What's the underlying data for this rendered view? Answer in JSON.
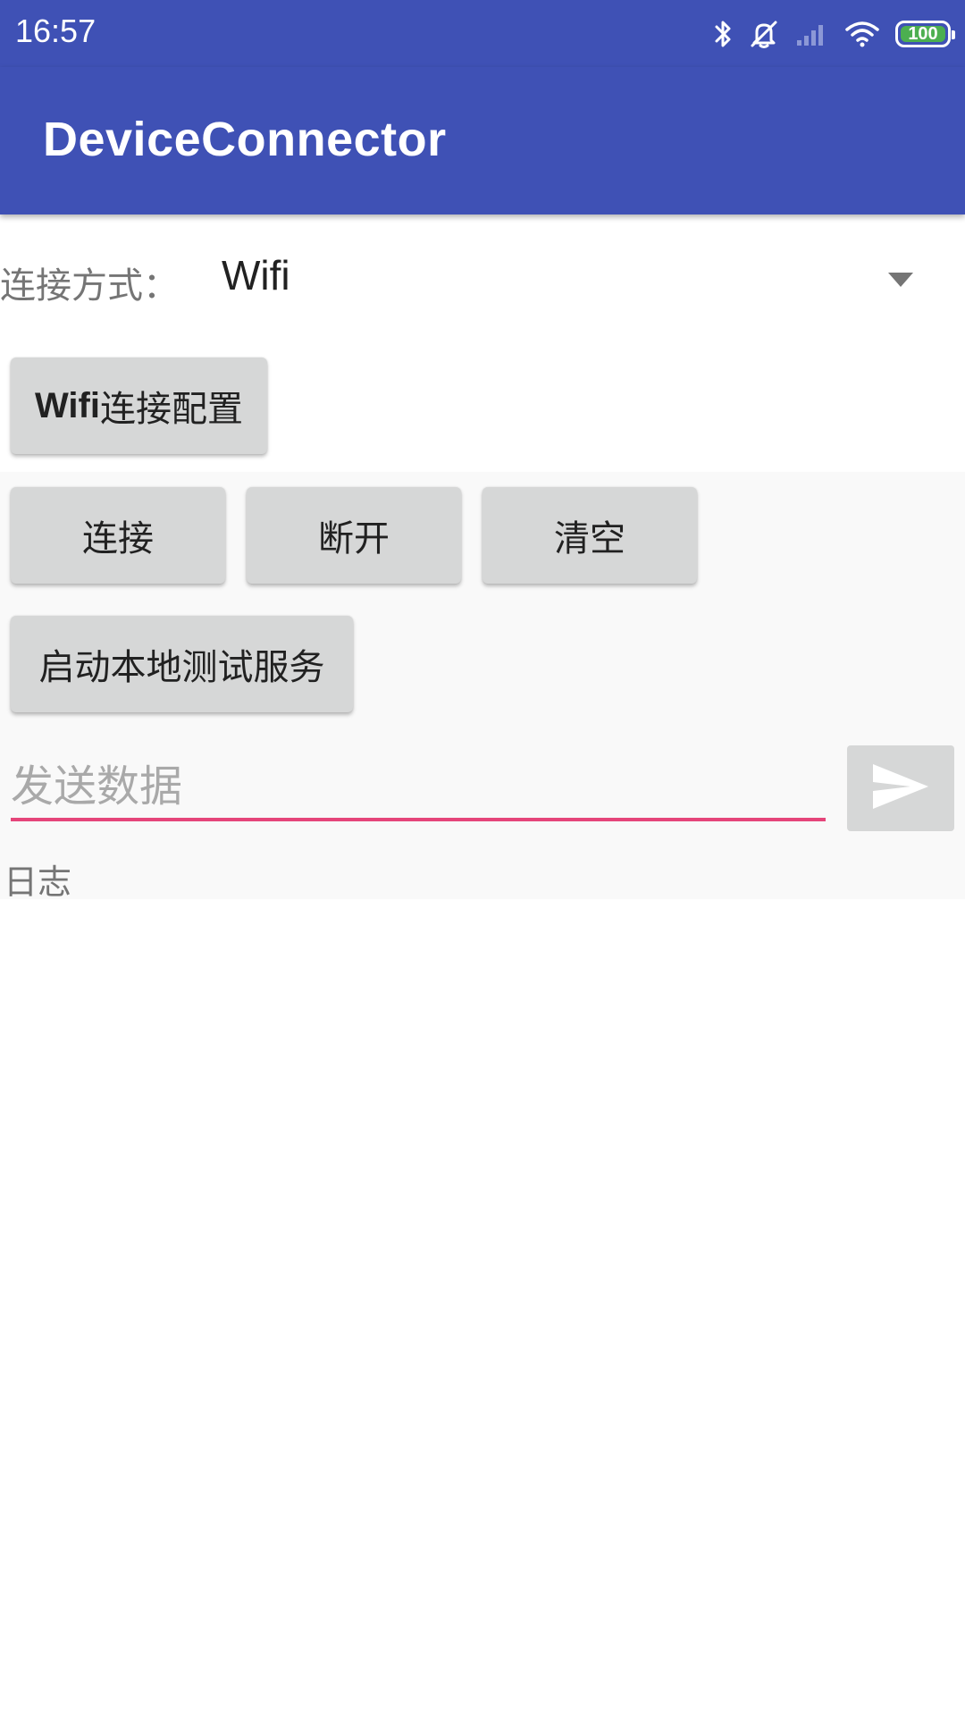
{
  "status_bar": {
    "time": "16:57",
    "icons": [
      "bluetooth-icon",
      "alarm-off-icon",
      "cell-signal-icon",
      "wifi-icon",
      "battery-icon"
    ],
    "battery_level": "100"
  },
  "app_bar": {
    "title": "DeviceConnector",
    "color": "#3f51b5"
  },
  "connection": {
    "label": "连接方式：",
    "selected": "Wifi"
  },
  "buttons": {
    "wifi_config_latin": "Wifi",
    "wifi_config_cjk": "连接配置",
    "connect": "连接",
    "disconnect": "断开",
    "clear": "清空",
    "local_test": "启动本地测试服务"
  },
  "send": {
    "placeholder": "发送数据",
    "value": ""
  },
  "log": {
    "label": "日志"
  },
  "colors": {
    "accent": "#e5457a",
    "button_bg": "#d6d7d7",
    "battery": "#4caf50"
  }
}
